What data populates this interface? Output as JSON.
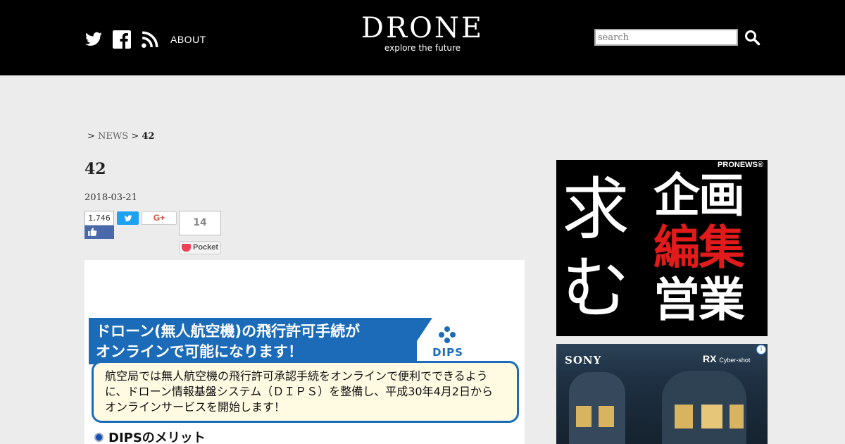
{
  "header": {
    "about_label": "ABOUT",
    "logo_title": "DRONE",
    "logo_tagline": "explore the future",
    "search_placeholder": "search",
    "icons": [
      "twitter-icon",
      "facebook-icon",
      "rss-icon",
      "search-icon"
    ]
  },
  "breadcrumb": {
    "sep1": ">",
    "link": "NEWS",
    "sep2": ">",
    "current": "42"
  },
  "article": {
    "title": "42",
    "date": "2018-03-21",
    "share": {
      "facebook_count": "1,746",
      "google_label": "G+",
      "pocket_count": "14",
      "pocket_label": "Pocket"
    },
    "image": {
      "banner_line1": "ドローン(無人航空機)の飛行許可手続が",
      "banner_line2": "オンラインで可能になります！",
      "dips_name": "DIPS",
      "info_line1": "航空局では無人航空機の飛行許可承認手続をオンラインで便利でできるよう",
      "info_line2": "に、ドローン情報基盤システム（ＤＩＰＳ）を整備し、平成30年4月2日から",
      "info_line3": "オンラインサービスを開始します！",
      "merit_heading": "DIPSのメリット"
    }
  },
  "ads": {
    "ad1": {
      "brand": "PRONEWS®",
      "big_text": "求む",
      "row1": "企画",
      "row2": "編集",
      "row3": "営業"
    },
    "ad2": {
      "brand": "SONY",
      "product": "RX",
      "product_sub": "Cyber-shot",
      "info_icon": "i"
    }
  },
  "colors": {
    "header_bg": "#000000",
    "page_bg": "#ececec",
    "dips_blue": "#1b6bb8",
    "ad_red": "#e11b1b"
  }
}
